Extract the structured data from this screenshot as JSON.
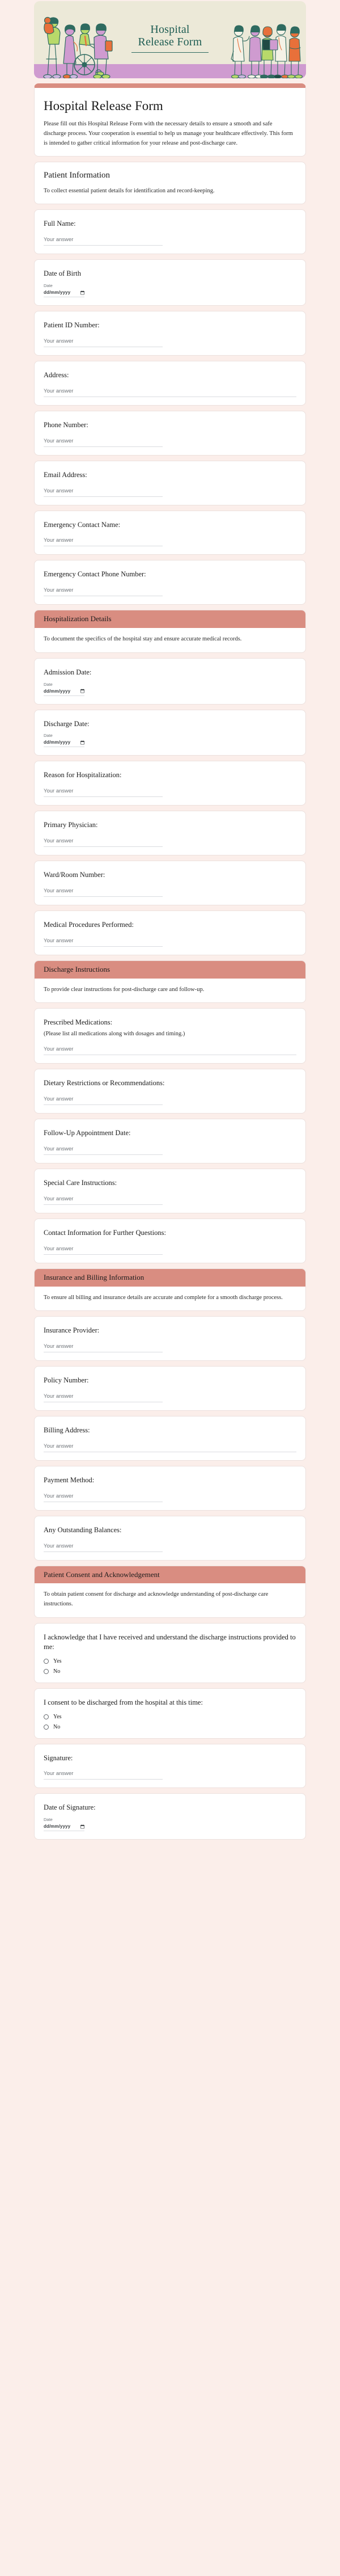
{
  "banner": {
    "title_line1": "Hospital",
    "title_line2": "Release Form",
    "background_color": "#ece9d8",
    "floor_color": "#cf9bd0",
    "title_color": "#1d5c52"
  },
  "page_background": "#fbeeea",
  "accent_color": "#d98d81",
  "header": {
    "title": "Hospital Release Form",
    "description": "Please fill out this Hospital Release Form with the necessary details to ensure a smooth and safe discharge process. Your cooperation is essential to help us manage your healthcare effectively. This form is intended to gather critical information for your release and post-discharge care."
  },
  "placeholders": {
    "answer": "Your answer",
    "date_caption": "Date",
    "date_value": "dd/mm/yyyy"
  },
  "sections": [
    {
      "title": "Patient Information",
      "description": "To collect essential patient details for identification and record-keeping.",
      "header_style": "plain",
      "questions": [
        {
          "label": "Full Name:",
          "type": "short"
        },
        {
          "label": "Date of Birth",
          "type": "date"
        },
        {
          "label": "Patient ID Number:",
          "type": "short"
        },
        {
          "label": "Address:",
          "type": "paragraph"
        },
        {
          "label": "Phone Number:",
          "type": "short"
        },
        {
          "label": "Email Address:",
          "type": "short"
        },
        {
          "label": "Emergency Contact Name:",
          "type": "short"
        },
        {
          "label": "Emergency Contact Phone Number:",
          "type": "short"
        }
      ]
    },
    {
      "title": "Hospitalization Details",
      "description": "To document the specifics of the hospital stay and ensure accurate medical records.",
      "header_style": "accent",
      "questions": [
        {
          "label": "Admission Date:",
          "type": "date"
        },
        {
          "label": "Discharge Date:",
          "type": "date"
        },
        {
          "label": "Reason for Hospitalization:",
          "type": "short"
        },
        {
          "label": "Primary Physician:",
          "type": "short"
        },
        {
          "label": "Ward/Room Number:",
          "type": "short"
        },
        {
          "label": "Medical Procedures Performed:",
          "type": "short"
        }
      ]
    },
    {
      "title": "Discharge Instructions",
      "description": "To provide clear instructions for post-discharge care and follow-up.",
      "header_style": "accent",
      "questions": [
        {
          "label": "Prescribed Medications:",
          "help": "(Please list all medications along with dosages and timing.)",
          "type": "paragraph"
        },
        {
          "label": "Dietary Restrictions or Recommendations:",
          "type": "short"
        },
        {
          "label": "Follow-Up Appointment Date:",
          "type": "short"
        },
        {
          "label": "Special Care Instructions:",
          "type": "short"
        },
        {
          "label": "Contact Information for Further Questions:",
          "type": "short"
        }
      ]
    },
    {
      "title": "Insurance and Billing Information",
      "description": "To ensure all billing and insurance details are accurate and complete for a smooth discharge process.",
      "header_style": "accent",
      "questions": [
        {
          "label": "Insurance Provider:",
          "type": "short"
        },
        {
          "label": "Policy Number:",
          "type": "short"
        },
        {
          "label": "Billing Address:",
          "type": "paragraph"
        },
        {
          "label": "Payment Method:",
          "type": "short"
        },
        {
          "label": "Any Outstanding Balances:",
          "type": "short"
        }
      ]
    },
    {
      "title": "Patient Consent and Acknowledgement",
      "description": "To obtain patient consent for discharge and acknowledge understanding of post-discharge care instructions.",
      "header_style": "accent",
      "questions": [
        {
          "label": "I acknowledge that I have received and understand the discharge instructions provided to me:",
          "type": "radio",
          "options": [
            "Yes",
            "No"
          ]
        },
        {
          "label": "I consent to be discharged from the hospital at this time:",
          "type": "radio",
          "options": [
            "Yes",
            "No"
          ]
        },
        {
          "label": "Signature:",
          "type": "short"
        },
        {
          "label": "Date of Signature:",
          "type": "date"
        }
      ]
    }
  ]
}
